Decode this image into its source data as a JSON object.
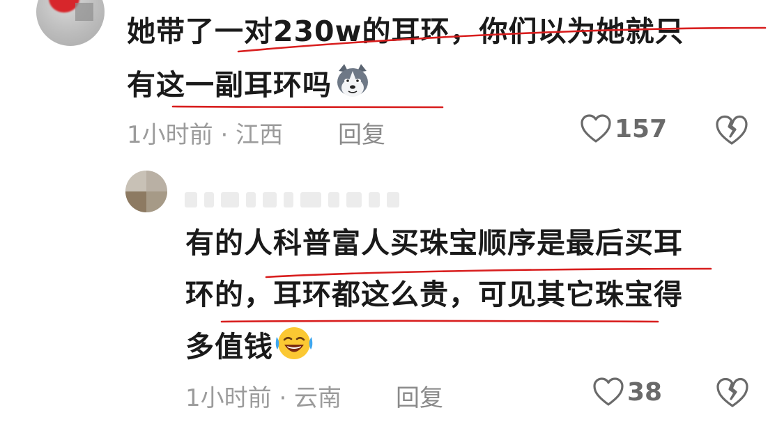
{
  "comment": {
    "line1": "她带了一对230w的耳环，你们以为她就只",
    "line2": "有这一副耳环吗",
    "emoji": "husky-emoji",
    "meta": "1小时前 · 江西",
    "reply_label": "回复",
    "like_count": "157"
  },
  "reply": {
    "line1": "有的人科普富人买珠宝顺序是最后买耳",
    "line2": "环的，耳环都这么贵，可见其它珠宝得",
    "line3": "多值钱",
    "emoji": "laughing-crying-emoji",
    "meta": "1小时前 · 云南",
    "reply_label": "回复",
    "like_count": "38"
  },
  "colors": {
    "text": "#1a1a1a",
    "meta": "#9b9b9b",
    "icon": "#6a6a6a",
    "underline": "#d81e1e"
  }
}
